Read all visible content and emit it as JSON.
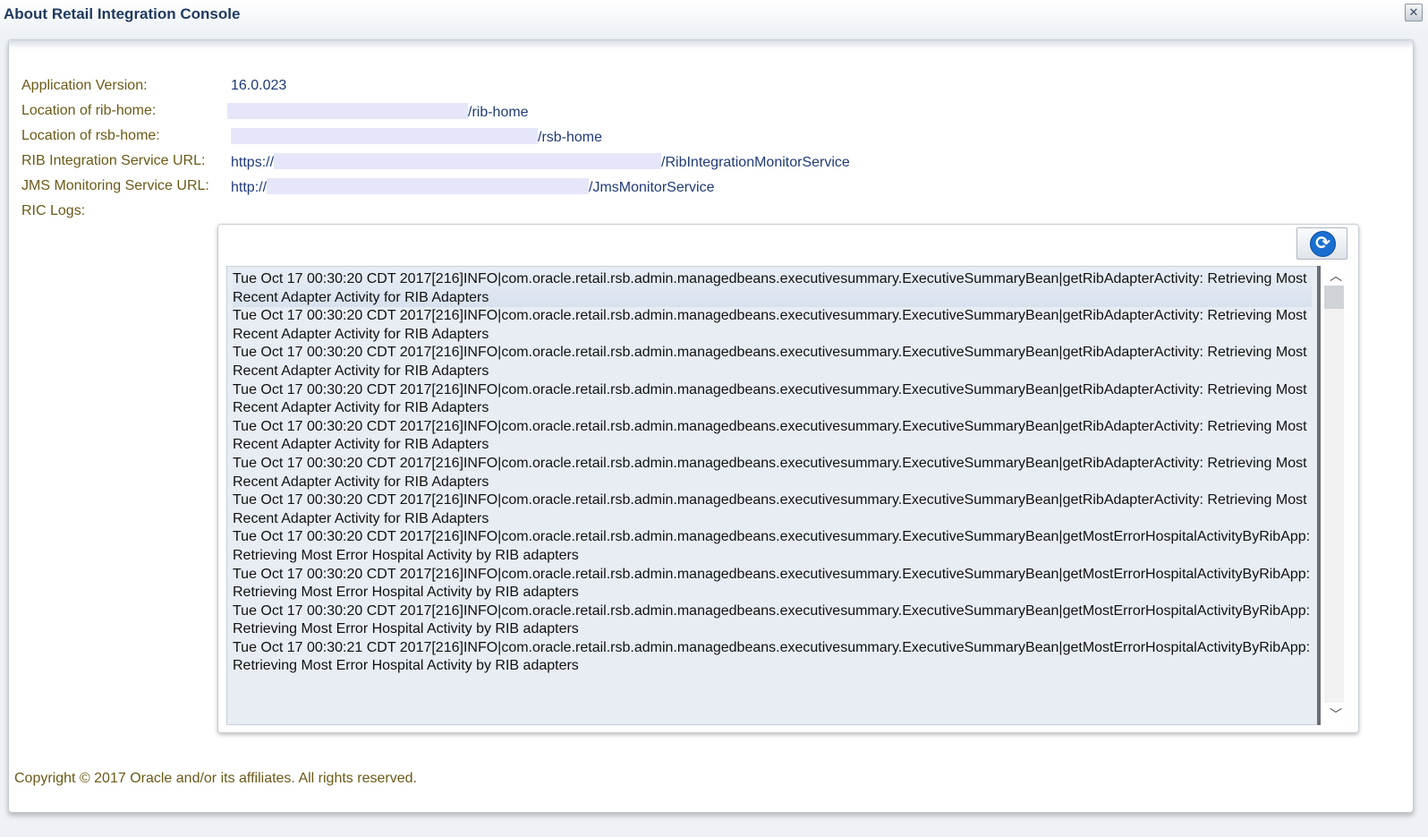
{
  "window": {
    "title": "About Retail Integration Console",
    "close_icon": "✕"
  },
  "info": [
    {
      "label": "Application Version:",
      "value_prefix": "",
      "value_suffix": "16.0.023"
    },
    {
      "label": "Location of rib-home:",
      "value_prefix": "",
      "value_suffix": "/rib-home"
    },
    {
      "label": "Location of rsb-home:",
      "value_prefix": "",
      "value_suffix": "/rsb-home"
    },
    {
      "label": "RIB Integration Service URL:",
      "value_prefix": "https://",
      "value_suffix": "/RibIntegrationMonitorService"
    },
    {
      "label": "JMS Monitoring Service URL:",
      "value_prefix": "http://",
      "value_suffix": "/JmsMonitorService"
    },
    {
      "label": "RIC Logs:",
      "value_prefix": "",
      "value_suffix": ""
    }
  ],
  "logs": {
    "refresh_icon": "⟳",
    "entries": [
      "Tue Oct 17 00:30:20 CDT 2017[216]INFO|com.oracle.retail.rsb.admin.managedbeans.executivesummary.ExecutiveSummaryBean|getRibAdapterActivity: Retrieving Most Recent Adapter Activity for RIB Adapters",
      "Tue Oct 17 00:30:20 CDT 2017[216]INFO|com.oracle.retail.rsb.admin.managedbeans.executivesummary.ExecutiveSummaryBean|getRibAdapterActivity: Retrieving Most Recent Adapter Activity for RIB Adapters",
      "Tue Oct 17 00:30:20 CDT 2017[216]INFO|com.oracle.retail.rsb.admin.managedbeans.executivesummary.ExecutiveSummaryBean|getRibAdapterActivity: Retrieving Most Recent Adapter Activity for RIB Adapters",
      "Tue Oct 17 00:30:20 CDT 2017[216]INFO|com.oracle.retail.rsb.admin.managedbeans.executivesummary.ExecutiveSummaryBean|getRibAdapterActivity: Retrieving Most Recent Adapter Activity for RIB Adapters",
      "Tue Oct 17 00:30:20 CDT 2017[216]INFO|com.oracle.retail.rsb.admin.managedbeans.executivesummary.ExecutiveSummaryBean|getRibAdapterActivity: Retrieving Most Recent Adapter Activity for RIB Adapters",
      "Tue Oct 17 00:30:20 CDT 2017[216]INFO|com.oracle.retail.rsb.admin.managedbeans.executivesummary.ExecutiveSummaryBean|getRibAdapterActivity: Retrieving Most Recent Adapter Activity for RIB Adapters",
      "Tue Oct 17 00:30:20 CDT 2017[216]INFO|com.oracle.retail.rsb.admin.managedbeans.executivesummary.ExecutiveSummaryBean|getRibAdapterActivity: Retrieving Most Recent Adapter Activity for RIB Adapters",
      "Tue Oct 17 00:30:20 CDT 2017[216]INFO|com.oracle.retail.rsb.admin.managedbeans.executivesummary.ExecutiveSummaryBean|getMostErrorHospitalActivityByRibApp: Retrieving Most Error Hospital Activity by RIB adapters",
      "Tue Oct 17 00:30:20 CDT 2017[216]INFO|com.oracle.retail.rsb.admin.managedbeans.executivesummary.ExecutiveSummaryBean|getMostErrorHospitalActivityByRibApp: Retrieving Most Error Hospital Activity by RIB adapters",
      "Tue Oct 17 00:30:20 CDT 2017[216]INFO|com.oracle.retail.rsb.admin.managedbeans.executivesummary.ExecutiveSummaryBean|getMostErrorHospitalActivityByRibApp: Retrieving Most Error Hospital Activity by RIB adapters",
      "Tue Oct 17 00:30:21 CDT 2017[216]INFO|com.oracle.retail.rsb.admin.managedbeans.executivesummary.ExecutiveSummaryBean|getMostErrorHospitalActivityByRibApp: Retrieving Most Error Hospital Activity by RIB adapters"
    ],
    "scroll_up_icon": "︿",
    "scroll_down_icon": "﹀"
  },
  "footer": {
    "copyright": "Copyright © 2017 Oracle and/or its affiliates. All rights reserved."
  }
}
